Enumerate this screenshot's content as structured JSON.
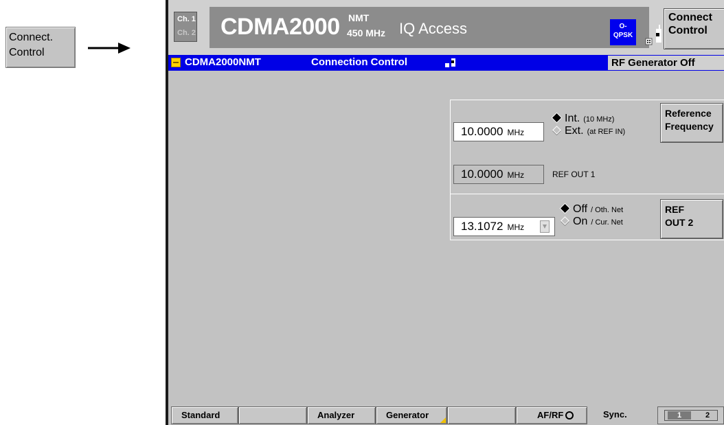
{
  "external_key": {
    "line1": "Connect.",
    "line2": "Control"
  },
  "header": {
    "ch1": "Ch. 1",
    "ch2": "Ch. 2",
    "title": "CDMA2000",
    "title_sup": "NMT",
    "title_sub": "450 MHz",
    "mode": "IQ Access",
    "modulation_line1": "O-",
    "modulation_line2": "QPSK",
    "softkey_line1": "Connect",
    "softkey_line2": "Control",
    "colors": {
      "panel": "#8c8c8c",
      "modulation_badge": "#0000ee",
      "hand_button": "#2d9a9a"
    },
    "icons": {
      "connection": "connection-status-icon",
      "hand": "hand-pointer-icon"
    }
  },
  "status_bar": {
    "standard": "CDMA2000NMT",
    "menu": "Connection Control",
    "generator_state": "RF Generator Off",
    "color": "#0000e6"
  },
  "reference": {
    "frequency_value": "10.0000",
    "frequency_unit": "MHz",
    "int_label": "Int.",
    "int_hint": "(10 MHz)",
    "ext_label": "Ext.",
    "ext_hint": "(at REF IN)",
    "selected": "Int.",
    "refout1_value": "10.0000",
    "refout1_unit": "MHz",
    "refout1_label": "REF OUT 1",
    "softkey_line1": "Reference",
    "softkey_line2": "Frequency"
  },
  "ref_out2": {
    "value": "13.1072",
    "unit": "MHz",
    "off_label": "Off",
    "off_hint": "/ Oth. Net",
    "on_label": "On",
    "on_hint": "/ Cur. Net",
    "selected": "Off",
    "softkey_line1": "REF",
    "softkey_line2": "OUT 2"
  },
  "bottom_tabs": {
    "standard": "Standard",
    "analyzer": "Analyzer",
    "generator": "Generator",
    "afrf": "AF/RF",
    "sync": "Sync.",
    "page1": "1",
    "page2": "2"
  }
}
